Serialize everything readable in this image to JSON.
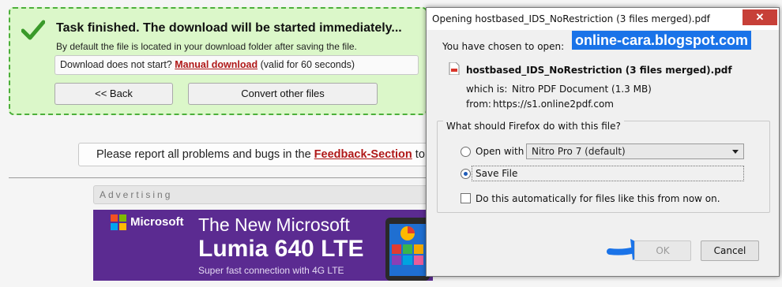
{
  "page": {
    "task_title": "Task finished. The download will be started immediately...",
    "task_subtitle": "By default the file is located in your download folder after saving the file.",
    "manual_prefix": "Download does not start?",
    "manual_link": "Manual download",
    "manual_suffix": "(valid for 60 seconds)",
    "back_button": "<< Back",
    "convert_button": "Convert other files",
    "feedback_prefix": "Please report all problems and bugs in the",
    "feedback_link": "Feedback-Section",
    "feedback_suffix": "to",
    "advertising_label": "Advertising",
    "ad": {
      "brand": "Microsoft",
      "headline": "The New Microsoft",
      "model": "Lumia 640 LTE",
      "tagline": "Super fast connection with 4G LTE"
    }
  },
  "dialog": {
    "title": "Opening hostbased_IDS_NoRestriction (3 files merged).pdf",
    "close_label": "✕",
    "intro": "You have chosen to open:",
    "watermark": "online-cara.blogspot.com",
    "filename": "hostbased_IDS_NoRestriction (3 files merged).pdf",
    "which_is_label": "which is:",
    "which_is_value": "Nitro PDF Document (1.3 MB)",
    "from_label": "from:",
    "from_value": "https://s1.online2pdf.com",
    "question": "What should Firefox do with this file?",
    "open_with_label": "Open with",
    "open_with_app": "Nitro Pro 7 (default)",
    "save_file_label": "Save File",
    "auto_label": "Do this automatically for files like this from now on.",
    "ok_button": "OK",
    "cancel_button": "Cancel",
    "selected_option": "Save File"
  },
  "colors": {
    "success_bg": "#dbf7c9",
    "success_border": "#4caf3a",
    "link_red": "#b01818",
    "ad_purple": "#5b2b91",
    "watermark_blue": "#1a73e8",
    "close_red": "#c74038"
  },
  "icons": [
    "checkmark-icon",
    "pdf-file-icon",
    "chevron-down-icon",
    "microsoft-logo",
    "blue-arrow-icon"
  ]
}
